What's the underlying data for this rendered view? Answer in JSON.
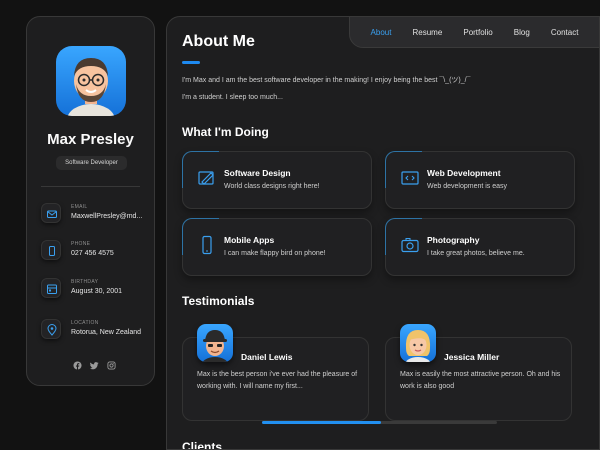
{
  "sidebar": {
    "name": "Max Presley",
    "title": "Software Developer",
    "contacts": [
      {
        "label": "EMAIL",
        "value": "MaxwellPresley@md...",
        "icon": "mail-icon"
      },
      {
        "label": "PHONE",
        "value": "027 456 4575",
        "icon": "phone-icon"
      },
      {
        "label": "BIRTHDAY",
        "value": "August 30, 2001",
        "icon": "calendar-icon"
      },
      {
        "label": "LOCATION",
        "value": "Rotorua, New Zealand",
        "icon": "location-icon"
      }
    ],
    "socials": [
      "facebook-icon",
      "twitter-icon",
      "instagram-icon"
    ]
  },
  "nav": {
    "items": [
      "About",
      "Resume",
      "Portfolio",
      "Blog",
      "Contact"
    ],
    "active": "About"
  },
  "about": {
    "title": "About Me",
    "paragraphs": [
      "I'm Max and I am the best software developer in the making! I enjoy being the best  ¯\\_(ツ)_/¯",
      "I'm a student. I sleep too much..."
    ]
  },
  "services": {
    "heading": "What I'm Doing",
    "items": [
      {
        "title": "Software Design",
        "desc": "World class designs right here!",
        "icon": "design-icon"
      },
      {
        "title": "Web Development",
        "desc": "Web development is easy",
        "icon": "code-icon"
      },
      {
        "title": "Mobile Apps",
        "desc": "I can make flappy bird on phone!",
        "icon": "mobile-icon"
      },
      {
        "title": "Photography",
        "desc": "I take great photos, believe me.",
        "icon": "camera-icon"
      }
    ]
  },
  "testimonials": {
    "heading": "Testimonials",
    "items": [
      {
        "name": "Daniel Lewis",
        "text": "Max is the best person i've ever had the pleasure of working with. I will name my first..."
      },
      {
        "name": "Jessica Miller",
        "text": "Max is easily the most attractive person. Oh and his work is also good"
      }
    ]
  },
  "clients": {
    "heading": "Clients"
  },
  "colors": {
    "accent": "#1e8af0",
    "background": "#121212",
    "card": "#1e1e1f"
  }
}
